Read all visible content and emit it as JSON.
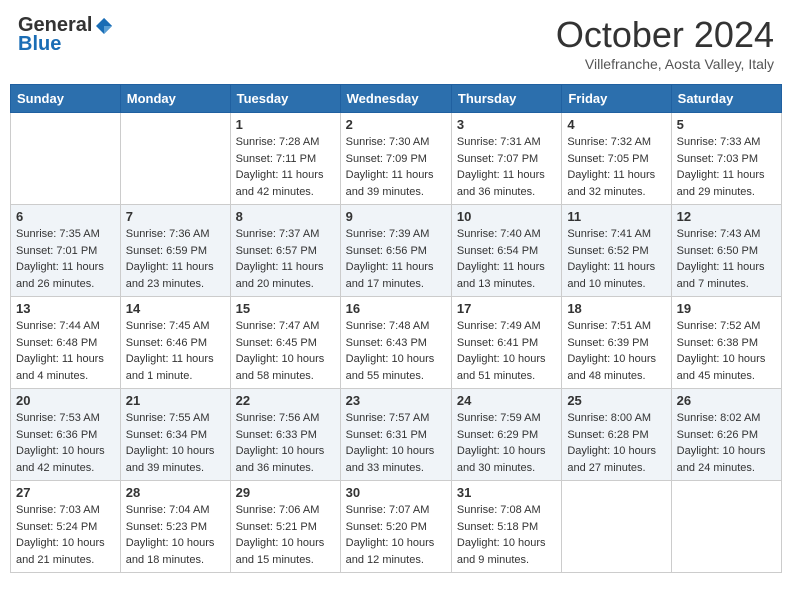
{
  "header": {
    "logo_general": "General",
    "logo_blue": "Blue",
    "month": "October 2024",
    "location": "Villefranche, Aosta Valley, Italy"
  },
  "weekdays": [
    "Sunday",
    "Monday",
    "Tuesday",
    "Wednesday",
    "Thursday",
    "Friday",
    "Saturday"
  ],
  "weeks": [
    [
      {
        "day": "",
        "sunrise": "",
        "sunset": "",
        "daylight": ""
      },
      {
        "day": "",
        "sunrise": "",
        "sunset": "",
        "daylight": ""
      },
      {
        "day": "1",
        "sunrise": "Sunrise: 7:28 AM",
        "sunset": "Sunset: 7:11 PM",
        "daylight": "Daylight: 11 hours and 42 minutes."
      },
      {
        "day": "2",
        "sunrise": "Sunrise: 7:30 AM",
        "sunset": "Sunset: 7:09 PM",
        "daylight": "Daylight: 11 hours and 39 minutes."
      },
      {
        "day": "3",
        "sunrise": "Sunrise: 7:31 AM",
        "sunset": "Sunset: 7:07 PM",
        "daylight": "Daylight: 11 hours and 36 minutes."
      },
      {
        "day": "4",
        "sunrise": "Sunrise: 7:32 AM",
        "sunset": "Sunset: 7:05 PM",
        "daylight": "Daylight: 11 hours and 32 minutes."
      },
      {
        "day": "5",
        "sunrise": "Sunrise: 7:33 AM",
        "sunset": "Sunset: 7:03 PM",
        "daylight": "Daylight: 11 hours and 29 minutes."
      }
    ],
    [
      {
        "day": "6",
        "sunrise": "Sunrise: 7:35 AM",
        "sunset": "Sunset: 7:01 PM",
        "daylight": "Daylight: 11 hours and 26 minutes."
      },
      {
        "day": "7",
        "sunrise": "Sunrise: 7:36 AM",
        "sunset": "Sunset: 6:59 PM",
        "daylight": "Daylight: 11 hours and 23 minutes."
      },
      {
        "day": "8",
        "sunrise": "Sunrise: 7:37 AM",
        "sunset": "Sunset: 6:57 PM",
        "daylight": "Daylight: 11 hours and 20 minutes."
      },
      {
        "day": "9",
        "sunrise": "Sunrise: 7:39 AM",
        "sunset": "Sunset: 6:56 PM",
        "daylight": "Daylight: 11 hours and 17 minutes."
      },
      {
        "day": "10",
        "sunrise": "Sunrise: 7:40 AM",
        "sunset": "Sunset: 6:54 PM",
        "daylight": "Daylight: 11 hours and 13 minutes."
      },
      {
        "day": "11",
        "sunrise": "Sunrise: 7:41 AM",
        "sunset": "Sunset: 6:52 PM",
        "daylight": "Daylight: 11 hours and 10 minutes."
      },
      {
        "day": "12",
        "sunrise": "Sunrise: 7:43 AM",
        "sunset": "Sunset: 6:50 PM",
        "daylight": "Daylight: 11 hours and 7 minutes."
      }
    ],
    [
      {
        "day": "13",
        "sunrise": "Sunrise: 7:44 AM",
        "sunset": "Sunset: 6:48 PM",
        "daylight": "Daylight: 11 hours and 4 minutes."
      },
      {
        "day": "14",
        "sunrise": "Sunrise: 7:45 AM",
        "sunset": "Sunset: 6:46 PM",
        "daylight": "Daylight: 11 hours and 1 minute."
      },
      {
        "day": "15",
        "sunrise": "Sunrise: 7:47 AM",
        "sunset": "Sunset: 6:45 PM",
        "daylight": "Daylight: 10 hours and 58 minutes."
      },
      {
        "day": "16",
        "sunrise": "Sunrise: 7:48 AM",
        "sunset": "Sunset: 6:43 PM",
        "daylight": "Daylight: 10 hours and 55 minutes."
      },
      {
        "day": "17",
        "sunrise": "Sunrise: 7:49 AM",
        "sunset": "Sunset: 6:41 PM",
        "daylight": "Daylight: 10 hours and 51 minutes."
      },
      {
        "day": "18",
        "sunrise": "Sunrise: 7:51 AM",
        "sunset": "Sunset: 6:39 PM",
        "daylight": "Daylight: 10 hours and 48 minutes."
      },
      {
        "day": "19",
        "sunrise": "Sunrise: 7:52 AM",
        "sunset": "Sunset: 6:38 PM",
        "daylight": "Daylight: 10 hours and 45 minutes."
      }
    ],
    [
      {
        "day": "20",
        "sunrise": "Sunrise: 7:53 AM",
        "sunset": "Sunset: 6:36 PM",
        "daylight": "Daylight: 10 hours and 42 minutes."
      },
      {
        "day": "21",
        "sunrise": "Sunrise: 7:55 AM",
        "sunset": "Sunset: 6:34 PM",
        "daylight": "Daylight: 10 hours and 39 minutes."
      },
      {
        "day": "22",
        "sunrise": "Sunrise: 7:56 AM",
        "sunset": "Sunset: 6:33 PM",
        "daylight": "Daylight: 10 hours and 36 minutes."
      },
      {
        "day": "23",
        "sunrise": "Sunrise: 7:57 AM",
        "sunset": "Sunset: 6:31 PM",
        "daylight": "Daylight: 10 hours and 33 minutes."
      },
      {
        "day": "24",
        "sunrise": "Sunrise: 7:59 AM",
        "sunset": "Sunset: 6:29 PM",
        "daylight": "Daylight: 10 hours and 30 minutes."
      },
      {
        "day": "25",
        "sunrise": "Sunrise: 8:00 AM",
        "sunset": "Sunset: 6:28 PM",
        "daylight": "Daylight: 10 hours and 27 minutes."
      },
      {
        "day": "26",
        "sunrise": "Sunrise: 8:02 AM",
        "sunset": "Sunset: 6:26 PM",
        "daylight": "Daylight: 10 hours and 24 minutes."
      }
    ],
    [
      {
        "day": "27",
        "sunrise": "Sunrise: 7:03 AM",
        "sunset": "Sunset: 5:24 PM",
        "daylight": "Daylight: 10 hours and 21 minutes."
      },
      {
        "day": "28",
        "sunrise": "Sunrise: 7:04 AM",
        "sunset": "Sunset: 5:23 PM",
        "daylight": "Daylight: 10 hours and 18 minutes."
      },
      {
        "day": "29",
        "sunrise": "Sunrise: 7:06 AM",
        "sunset": "Sunset: 5:21 PM",
        "daylight": "Daylight: 10 hours and 15 minutes."
      },
      {
        "day": "30",
        "sunrise": "Sunrise: 7:07 AM",
        "sunset": "Sunset: 5:20 PM",
        "daylight": "Daylight: 10 hours and 12 minutes."
      },
      {
        "day": "31",
        "sunrise": "Sunrise: 7:08 AM",
        "sunset": "Sunset: 5:18 PM",
        "daylight": "Daylight: 10 hours and 9 minutes."
      },
      {
        "day": "",
        "sunrise": "",
        "sunset": "",
        "daylight": ""
      },
      {
        "day": "",
        "sunrise": "",
        "sunset": "",
        "daylight": ""
      }
    ]
  ]
}
